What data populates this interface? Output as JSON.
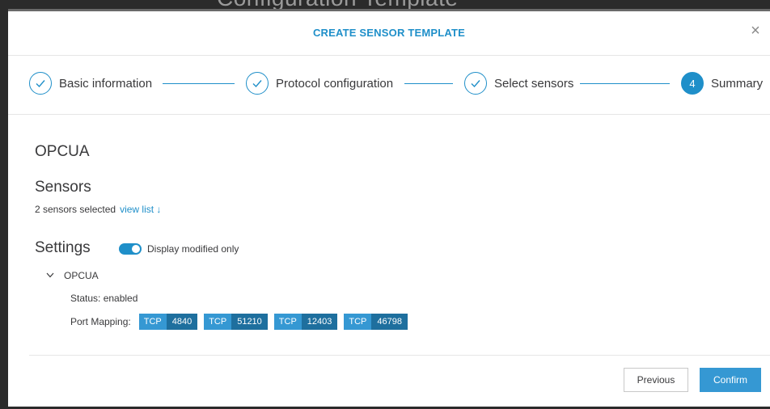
{
  "backdrop": {
    "title": "Configuration Template"
  },
  "modal": {
    "title": "CREATE SENSOR TEMPLATE",
    "close_icon": "close-icon"
  },
  "stepper": {
    "steps": [
      {
        "label": "Basic information",
        "state": "done",
        "icon": "check-icon"
      },
      {
        "label": "Protocol configuration",
        "state": "done",
        "icon": "check-icon"
      },
      {
        "label": "Select sensors",
        "state": "done",
        "icon": "check-icon"
      },
      {
        "label": "Summary",
        "state": "active",
        "number": "4"
      }
    ]
  },
  "summary": {
    "protocol": "OPCUA",
    "sensors_heading": "Sensors",
    "sensors_selected": "2 sensors selected",
    "view_list": "view list ↓",
    "settings_heading": "Settings",
    "display_modified_only": {
      "label": "Display modified only",
      "enabled": true
    },
    "tree": {
      "node_label": "OPCUA",
      "expanded": true,
      "status_text": "Status:  enabled",
      "port_mapping_label": "Port Mapping:",
      "ports": [
        {
          "proto": "TCP",
          "port": "4840"
        },
        {
          "proto": "TCP",
          "port": "51210"
        },
        {
          "proto": "TCP",
          "port": "12403"
        },
        {
          "proto": "TCP",
          "port": "46798"
        }
      ]
    }
  },
  "footer": {
    "previous_label": "Previous",
    "confirm_label": "Confirm"
  },
  "colors": {
    "accent": "#1f8fc9",
    "badge_proto": "#3598d3",
    "badge_port": "#1e6f9e"
  }
}
